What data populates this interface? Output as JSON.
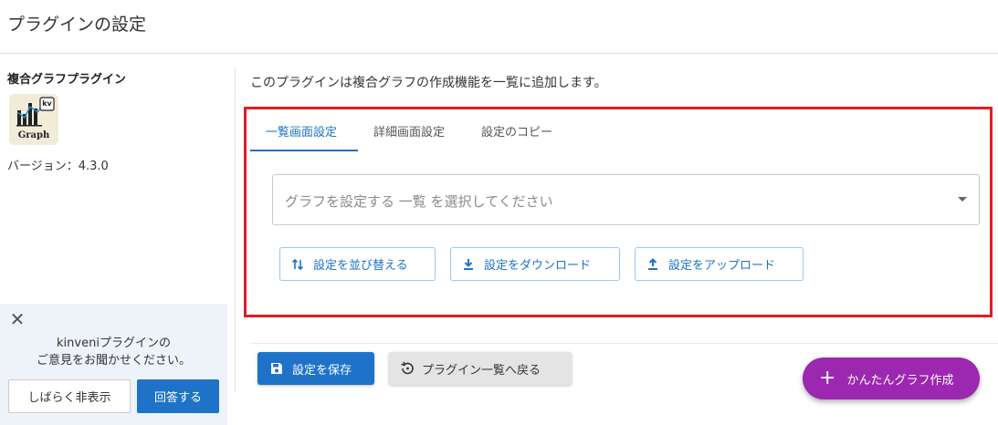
{
  "page": {
    "title": "プラグインの設定"
  },
  "sidebar": {
    "plugin_name": "複合グラフプラグイン",
    "logo": {
      "badge": "kv",
      "caption": "Graph",
      "background": "#f1ecd8"
    },
    "version": "バージョン：4.3.0"
  },
  "feedback": {
    "close_icon": "close-icon",
    "line1": "kinveniプラグインの",
    "line2": "ご意見をお聞かせください。",
    "later_label": "しばらく非表示",
    "answer_label": "回答する"
  },
  "main": {
    "description": "このプラグインは複合グラフの作成機能を一覧に追加します。",
    "tabs": [
      {
        "label": "一覧画面設定",
        "active": true
      },
      {
        "label": "詳細画面設定",
        "active": false
      },
      {
        "label": "設定のコピー",
        "active": false
      }
    ],
    "select": {
      "placeholder": "グラフを設定する 一覧 を選択してください"
    },
    "actions": {
      "sort_label": "設定を並び替える",
      "download_label": "設定をダウンロード",
      "upload_label": "設定をアップロード"
    }
  },
  "footer": {
    "save_label": "設定を保存",
    "back_label": "プラグイン一覧へ戻る",
    "fab_label": "かんたんグラフ作成"
  },
  "colors": {
    "primary": "#1e73c8",
    "fab": "#9c27b0",
    "highlight": "#e51c23",
    "feedback_bg": "#eef3fa"
  }
}
